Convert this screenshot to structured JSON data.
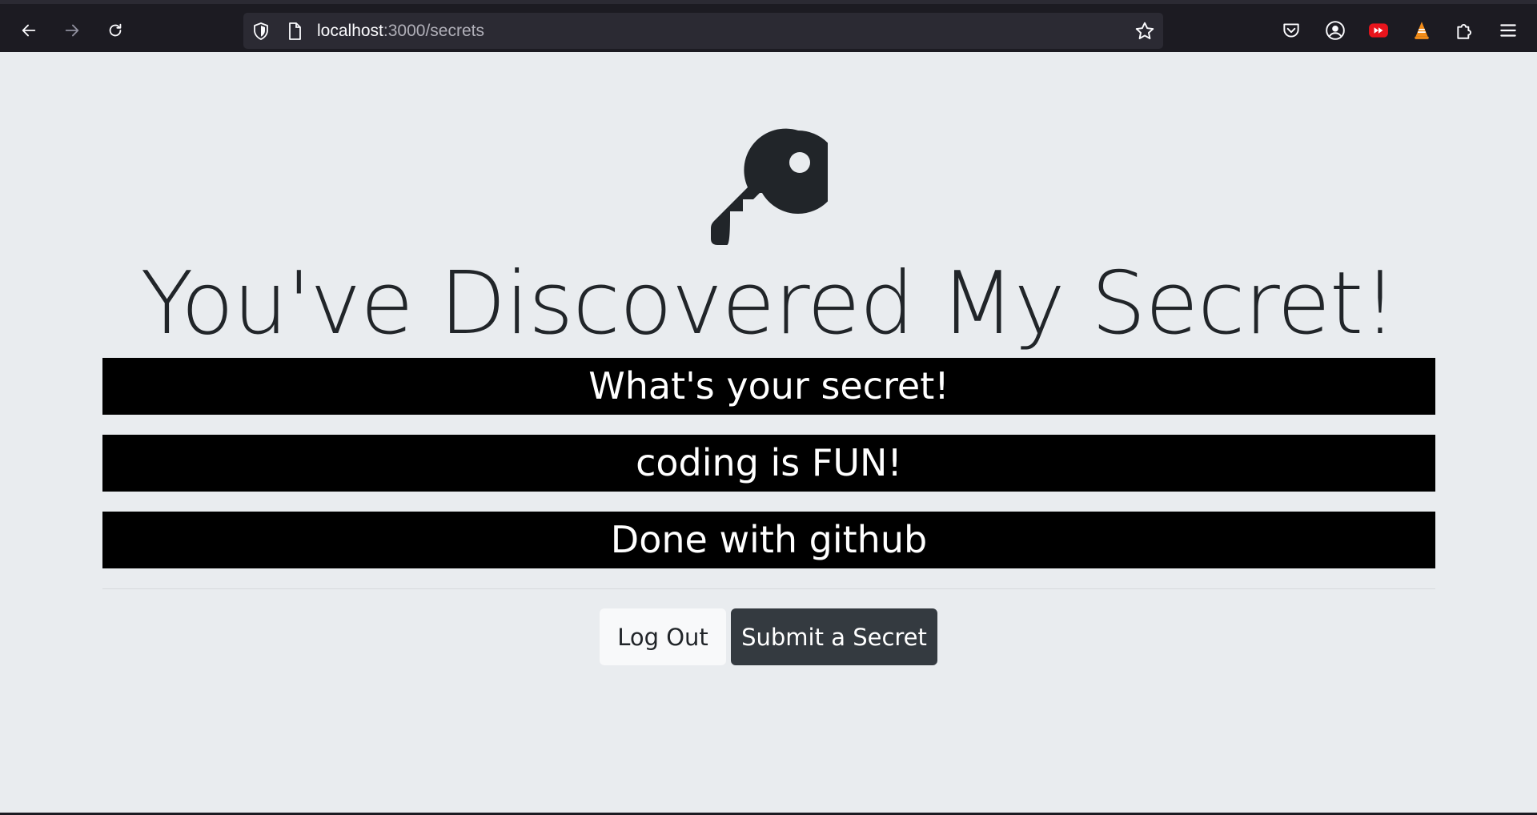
{
  "browser": {
    "url_host": "localhost",
    "url_path": ":3000/secrets"
  },
  "page": {
    "title": "You've Discovered My Secret!",
    "secrets": [
      "What's your secret!",
      "coding is FUN!",
      "Done with github"
    ],
    "buttons": {
      "logout": "Log Out",
      "submit": "Submit a Secret"
    }
  },
  "colors": {
    "background": "#e9ecef",
    "secret_box": "#000000",
    "dark_button": "#343a40",
    "light_button": "#f8f9fa"
  },
  "icons": [
    "back-icon",
    "forward-icon",
    "reload-icon",
    "shield-icon",
    "page-icon",
    "bookmark-star-icon",
    "pocket-icon",
    "account-icon",
    "youtube-extension-icon",
    "vlc-extension-icon",
    "extensions-icon",
    "menu-icon",
    "key-icon"
  ]
}
